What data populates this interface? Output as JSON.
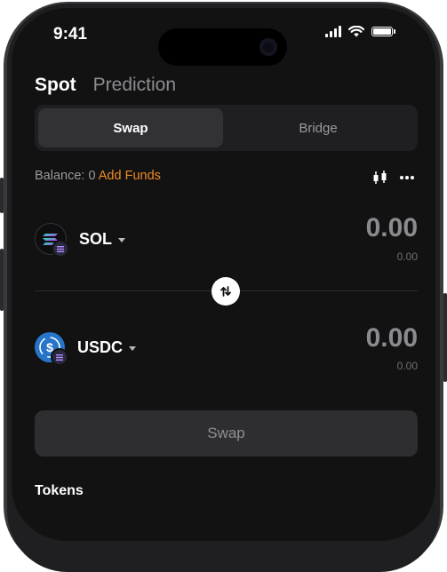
{
  "status_bar": {
    "time": "9:41"
  },
  "tabs": {
    "spot": "Spot",
    "prediction": "Prediction"
  },
  "segment": {
    "swap": "Swap",
    "bridge": "Bridge"
  },
  "balance": {
    "label": "Balance: 0",
    "add_funds": "Add Funds"
  },
  "from_token": {
    "symbol": "SOL",
    "amount": "0.00",
    "fiat": "0.00"
  },
  "to_token": {
    "symbol": "USDC",
    "amount": "0.00",
    "fiat": "0.00"
  },
  "actions": {
    "swap_button": "Swap"
  },
  "sections": {
    "tokens_title": "Tokens"
  },
  "colors": {
    "accent": "#f08a24",
    "background": "#121212"
  }
}
